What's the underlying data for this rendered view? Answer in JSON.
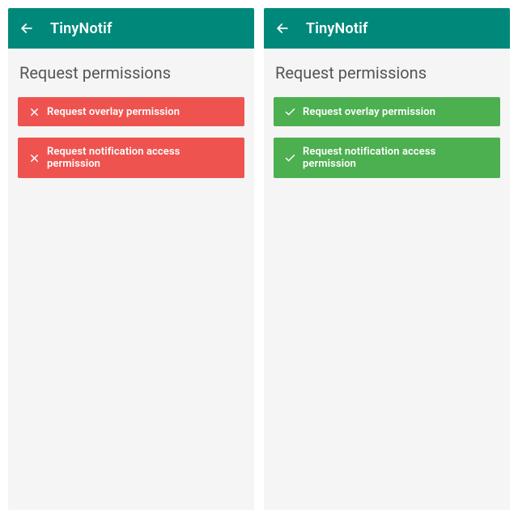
{
  "colors": {
    "appbar": "#00897b",
    "denied": "#ef5350",
    "granted": "#4caf50",
    "page_bg": "#f5f5f5"
  },
  "screens": [
    {
      "app_title": "TinyNotif",
      "section_title": "Request permissions",
      "permissions": [
        {
          "label": "Request overlay permission",
          "status": "denied"
        },
        {
          "label": "Request notification access permission",
          "status": "denied"
        }
      ]
    },
    {
      "app_title": "TinyNotif",
      "section_title": "Request permissions",
      "permissions": [
        {
          "label": "Request overlay permission",
          "status": "granted"
        },
        {
          "label": "Request notification access permission",
          "status": "granted"
        }
      ]
    }
  ]
}
